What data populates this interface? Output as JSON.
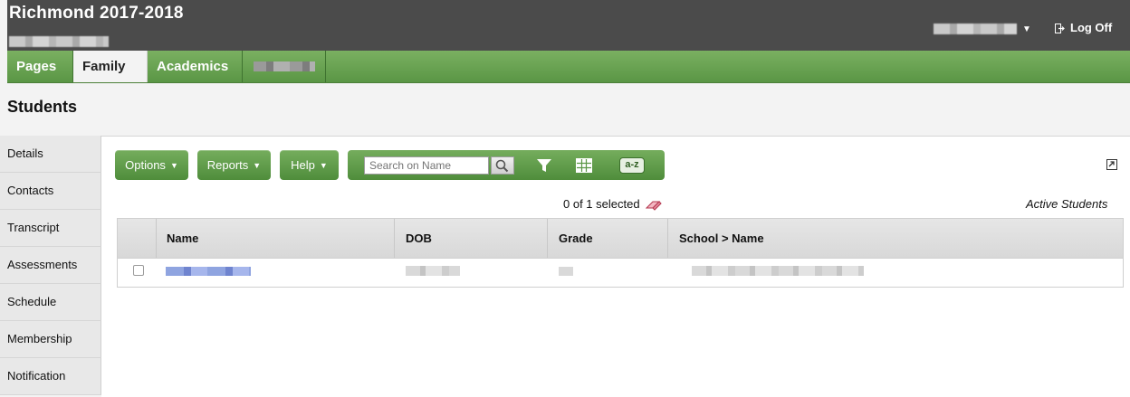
{
  "header": {
    "title": "Richmond 2017-2018",
    "logoff_label": "Log Off"
  },
  "tabs": [
    {
      "label": "Pages"
    },
    {
      "label": "Family"
    },
    {
      "label": "Academics"
    }
  ],
  "page_title": "Students",
  "sidenav": {
    "items": [
      {
        "label": "Details"
      },
      {
        "label": "Contacts"
      },
      {
        "label": "Transcript"
      },
      {
        "label": "Assessments"
      },
      {
        "label": "Schedule"
      },
      {
        "label": "Membership"
      },
      {
        "label": "Notification"
      }
    ]
  },
  "toolbar": {
    "options_label": "Options",
    "reports_label": "Reports",
    "help_label": "Help",
    "search_placeholder": "Search on Name",
    "sort_label": "a-z"
  },
  "selection": {
    "text": "0 of 1 selected"
  },
  "filter_label": "Active Students",
  "table": {
    "columns": [
      "Name",
      "DOB",
      "Grade",
      "School > Name"
    ]
  },
  "colors": {
    "header_bg": "#4b4b4b",
    "tab_green": "#5a9645",
    "button_green": "#5f9b48"
  }
}
